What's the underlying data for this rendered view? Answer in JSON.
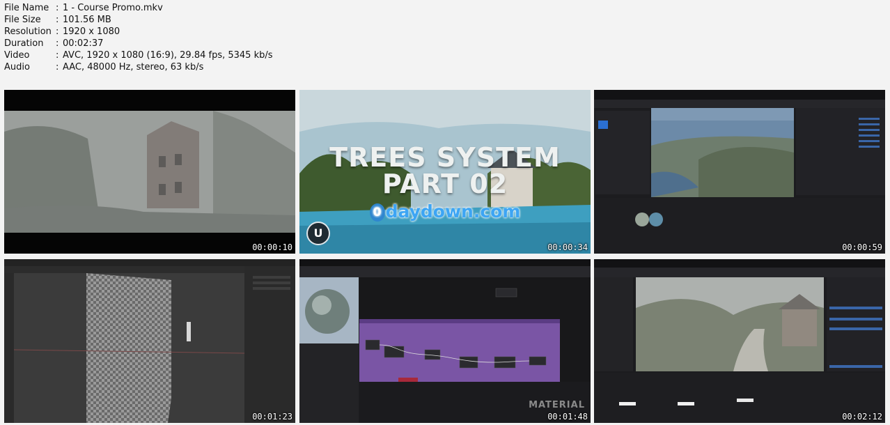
{
  "file_info": [
    {
      "key": "File Name",
      "value": "1 - Course Promo.mkv"
    },
    {
      "key": "File Size",
      "value": "101.56 MB"
    },
    {
      "key": "Resolution",
      "value": "1920 x 1080"
    },
    {
      "key": "Duration",
      "value": "00:02:37"
    },
    {
      "key": "Video",
      "value": "AVC, 1920 x 1080 (16:9), 29.84 fps, 5345 kb/s"
    },
    {
      "key": "Audio",
      "value": "AAC, 48000 Hz, stereo, 63 kb/s"
    }
  ],
  "separator": ":",
  "thumbnails": [
    {
      "timestamp": "00:00:10"
    },
    {
      "timestamp": "00:00:34",
      "title_line1": "TREES SYSTEM",
      "title_line2": "PART 02",
      "watermark": "daydown.com",
      "watermark_glyph": "0",
      "logo_letter": "U"
    },
    {
      "timestamp": "00:00:59"
    },
    {
      "timestamp": "00:01:23"
    },
    {
      "timestamp": "00:01:48",
      "overlay_text": "MATERIAL"
    },
    {
      "timestamp": "00:02:12"
    }
  ],
  "colors": {
    "page_bg": "#f3f3f3",
    "timestamp": "#ffffff",
    "watermark": "#3da5f4",
    "node_graph": "#7a55a5"
  }
}
